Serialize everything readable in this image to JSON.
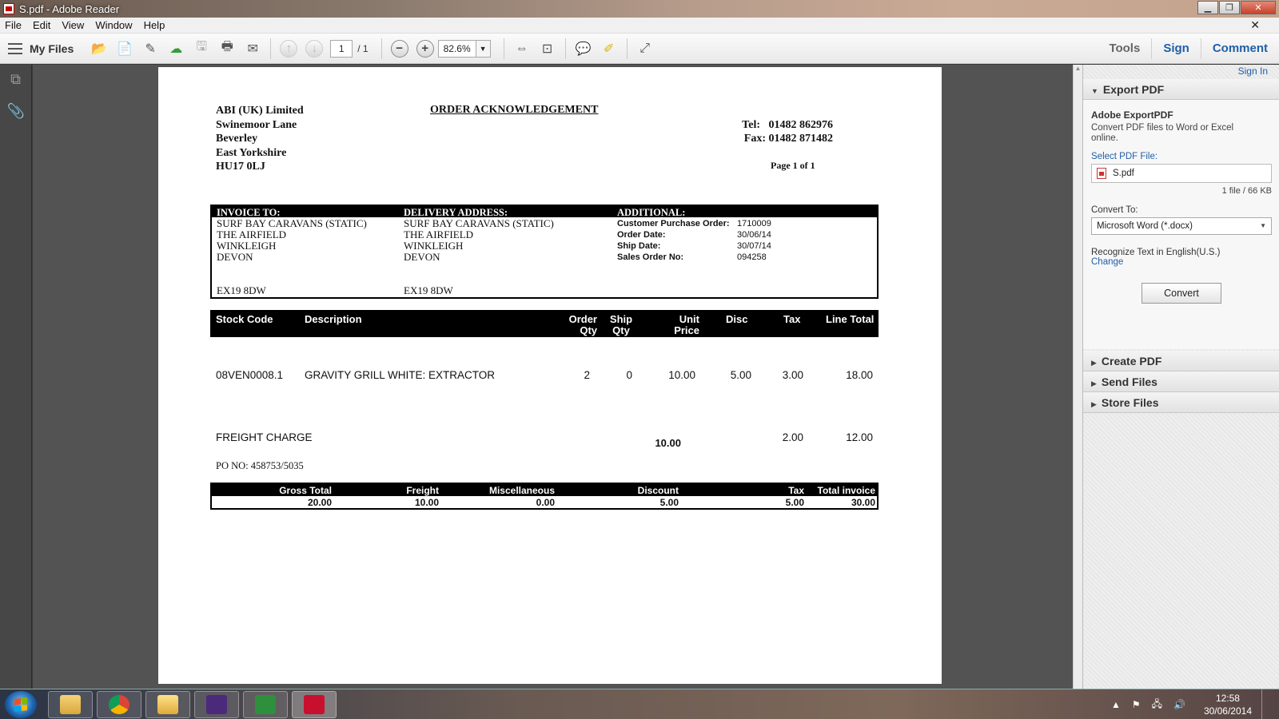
{
  "window": {
    "title": "S.pdf - Adobe Reader"
  },
  "menu": [
    "File",
    "Edit",
    "View",
    "Window",
    "Help"
  ],
  "toolbar": {
    "my_files": "My Files",
    "page_current": "1",
    "page_total": "/ 1",
    "zoom": "82.6%",
    "tools": "Tools",
    "sign": "Sign",
    "comment": "Comment"
  },
  "document": {
    "sender": [
      "ABI (UK) Limited",
      "Swinemoor Lane",
      "Beverley",
      "East Yorkshire",
      "HU17 0LJ"
    ],
    "title": "ORDER ACKNOWLEDGEMENT",
    "tel_label": "Tel:",
    "tel": "01482 862976",
    "fax_label": "Fax:",
    "fax": "01482 871482",
    "page_of": "Page 1 of 1",
    "invoice_to": {
      "heading": "INVOICE TO:",
      "lines": [
        "SURF BAY CARAVANS (STATIC)",
        "THE AIRFIELD",
        "WINKLEIGH",
        "DEVON"
      ],
      "postcode": "EX19 8DW"
    },
    "delivery": {
      "heading": "DELIVERY ADDRESS:",
      "lines": [
        "SURF BAY CARAVANS (STATIC)",
        "THE AIRFIELD",
        "WINKLEIGH",
        "DEVON"
      ],
      "postcode": "EX19 8DW"
    },
    "additional": {
      "heading": "ADDITIONAL:",
      "rows": [
        {
          "label": "Customer Purchase Order:",
          "value": "1710009"
        },
        {
          "label": "Order Date:",
          "value": "30/06/14"
        },
        {
          "label": "Ship Date:",
          "value": "30/07/14"
        },
        {
          "label": "Sales Order No:",
          "value": "094258"
        }
      ]
    },
    "line_headers": {
      "stock_code": "Stock Code",
      "description": "Description",
      "order_qty_1": "Order",
      "order_qty_2": "Qty",
      "ship_qty_1": "Ship",
      "ship_qty_2": "Qty",
      "unit_price_1": "Unit",
      "unit_price_2": "Price",
      "disc": "Disc",
      "tax": "Tax",
      "line_total": "Line Total"
    },
    "line_item": {
      "stock_code": "08VEN0008.1",
      "description": "GRAVITY GRILL WHITE: EXTRACTOR",
      "order_qty": "2",
      "ship_qty": "0",
      "unit_price": "10.00",
      "disc": "5.00",
      "tax": "3.00",
      "line_total": "18.00"
    },
    "freight": {
      "label": "FREIGHT CHARGE",
      "price": "10.00",
      "tax": "2.00",
      "total": "12.00"
    },
    "po_no": "PO NO: 458753/5035",
    "totals": {
      "gross_total_label": "Gross Total",
      "gross_total": "20.00",
      "freight_label": "Freight",
      "freight": "10.00",
      "misc_label": "Miscellaneous",
      "misc": "0.00",
      "discount_label": "Discount",
      "discount": "5.00",
      "tax_label": "Tax",
      "tax": "5.00",
      "total_label": "Total invoice",
      "total": "30.00"
    }
  },
  "rightpane": {
    "sign_in": "Sign In",
    "export_pdf": "Export PDF",
    "service_title": "Adobe ExportPDF",
    "service_desc": "Convert PDF files to Word or Excel online.",
    "select_label": "Select PDF File:",
    "file_name": "S.pdf",
    "file_meta": "1 file / 66 KB",
    "convert_to_label": "Convert To:",
    "convert_to_value": "Microsoft Word (*.docx)",
    "ocr_text": "Recognize Text in English(U.S.)",
    "change": "Change",
    "convert_button": "Convert",
    "create_pdf": "Create PDF",
    "send_files": "Send Files",
    "store_files": "Store Files"
  },
  "taskbar": {
    "time": "12:58",
    "date": "30/06/2014"
  }
}
